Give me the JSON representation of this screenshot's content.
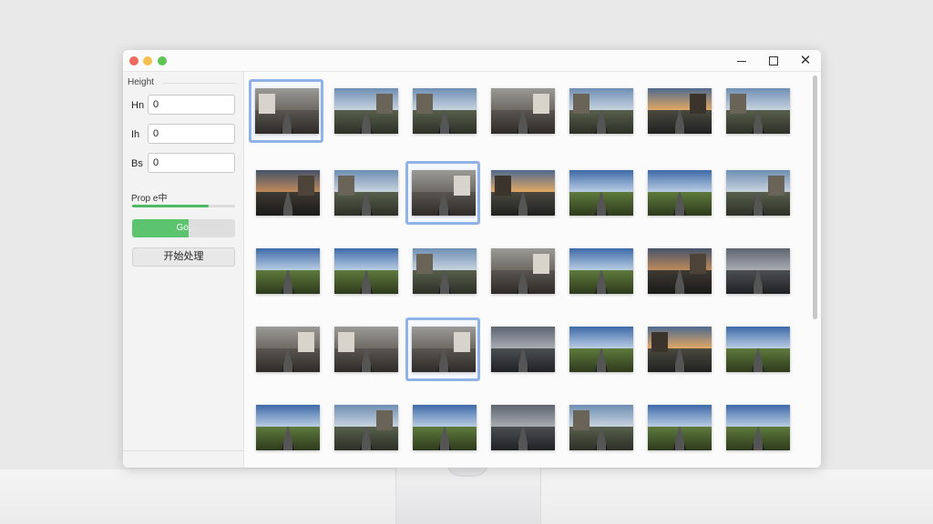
{
  "sidebar": {
    "group_title": "Height",
    "fields": [
      {
        "label": "Hn",
        "value": "0"
      },
      {
        "label": "Ih",
        "value": "0"
      },
      {
        "label": "Bs",
        "value": "0"
      }
    ],
    "progress_label": "Prop e中",
    "progress": 0.74,
    "go_label": "Go;",
    "go_progress": 0.55,
    "start_label": "开始处理"
  },
  "colors": {
    "accent_green": "#5cc46f",
    "selection_blue": "#8fb3e6"
  },
  "gallery": {
    "thumbnails": [
      {
        "scene": "interior",
        "selected": true
      },
      {
        "scene": "buildings"
      },
      {
        "scene": "buildings"
      },
      {
        "scene": "interior"
      },
      {
        "scene": "buildings"
      },
      {
        "scene": "sunset"
      },
      {
        "scene": "buildings"
      },
      {
        "scene": "dusk"
      },
      {
        "scene": "buildings"
      },
      {
        "scene": "interior",
        "selected": true
      },
      {
        "scene": "sunset"
      },
      {
        "scene": "field"
      },
      {
        "scene": "field"
      },
      {
        "scene": "buildings"
      },
      {
        "scene": "field"
      },
      {
        "scene": "field"
      },
      {
        "scene": "buildings"
      },
      {
        "scene": "interior"
      },
      {
        "scene": "field"
      },
      {
        "scene": "dusk"
      },
      {
        "scene": "overcast"
      },
      {
        "scene": "interior"
      },
      {
        "scene": "interior"
      },
      {
        "scene": "interior",
        "selected": true
      },
      {
        "scene": "overcast"
      },
      {
        "scene": "field"
      },
      {
        "scene": "sunset"
      },
      {
        "scene": "field"
      },
      {
        "scene": "field"
      },
      {
        "scene": "buildings"
      },
      {
        "scene": "field"
      },
      {
        "scene": "overcast"
      },
      {
        "scene": "buildings"
      },
      {
        "scene": "field"
      },
      {
        "scene": "field"
      }
    ]
  }
}
